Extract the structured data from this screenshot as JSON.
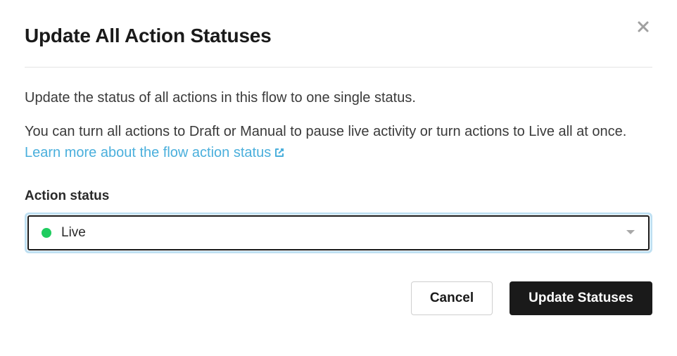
{
  "modal": {
    "title": "Update All Action Statuses",
    "description_1": "Update the status of all actions in this flow to one single status.",
    "description_2_prefix": "You can turn all actions to Draft or Manual to pause live activity or turn actions to Live all at once. ",
    "learn_more_label": "Learn more about the flow action status"
  },
  "field": {
    "label": "Action status",
    "selected_value": "Live",
    "status_color": "#1fcc5f"
  },
  "footer": {
    "cancel_label": "Cancel",
    "submit_label": "Update Statuses"
  }
}
